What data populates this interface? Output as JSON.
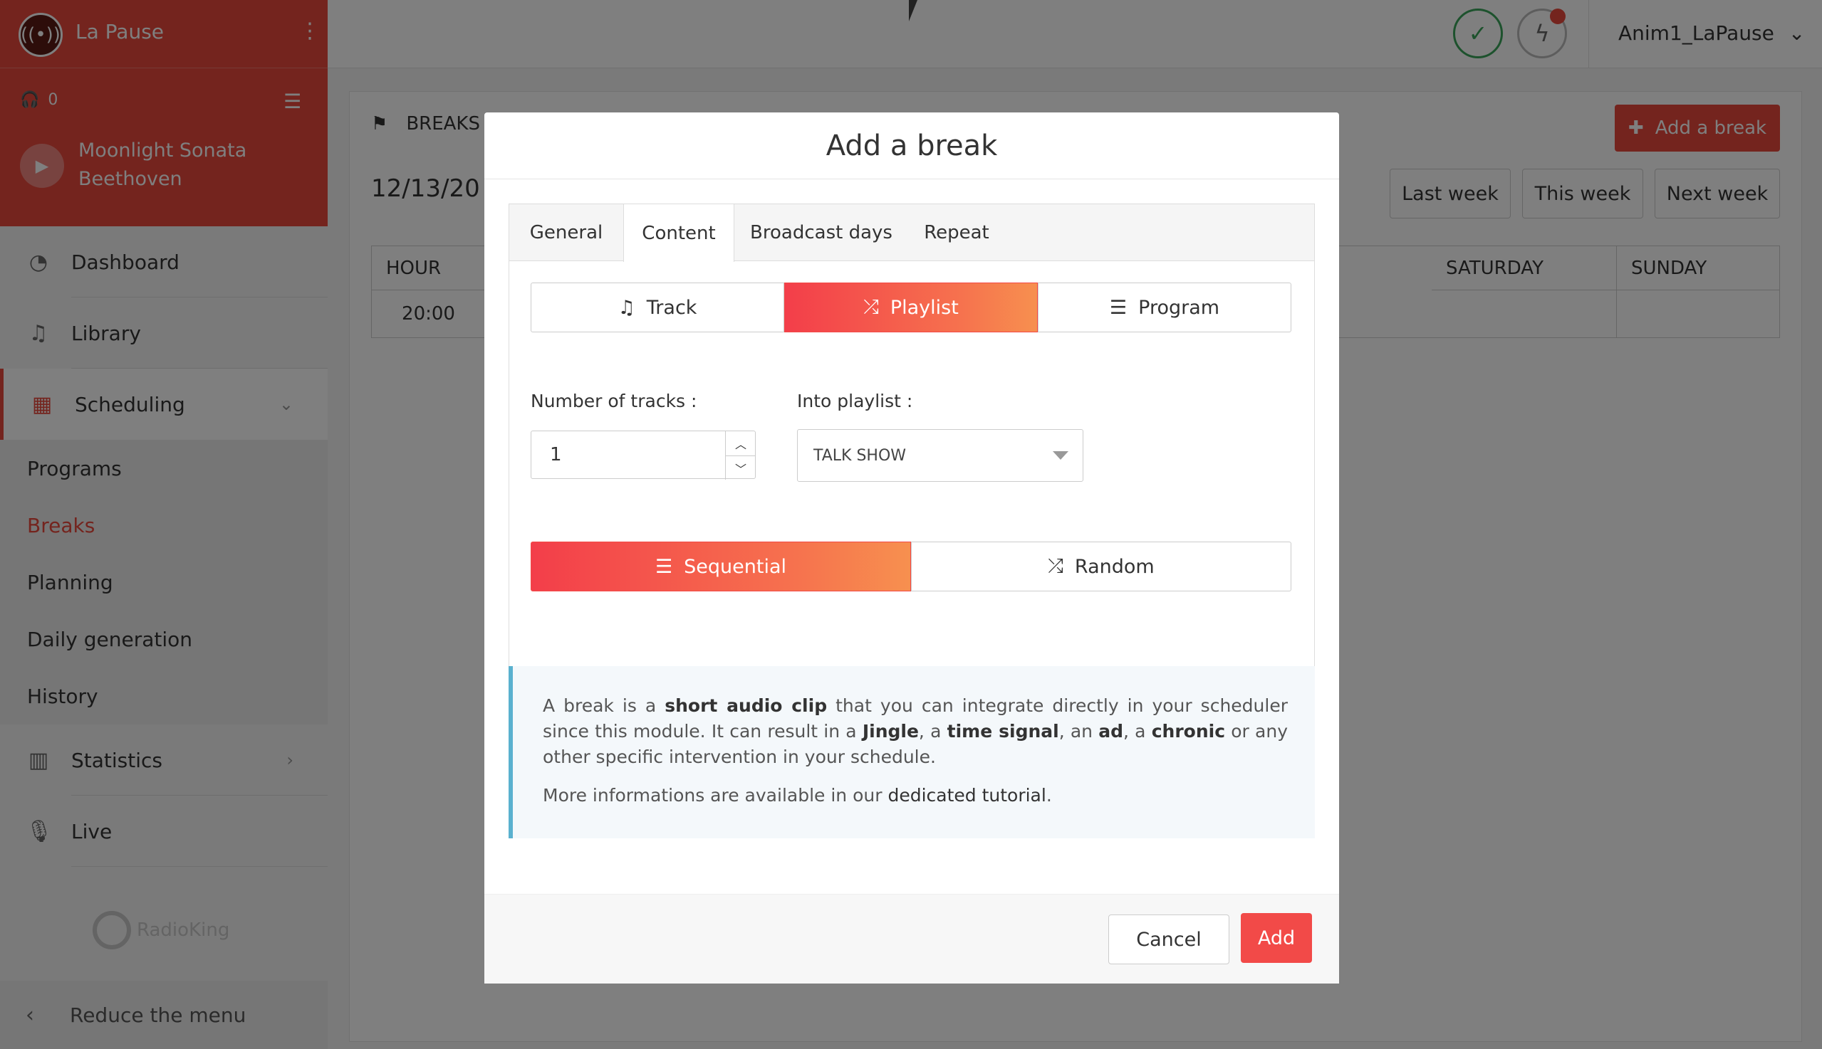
{
  "sidebar": {
    "radio_name": "La Pause",
    "listeners_count": "0",
    "now_playing": {
      "title": "Moonlight Sonata",
      "artist": "Beethoven"
    },
    "nav": {
      "dashboard": "Dashboard",
      "library": "Library",
      "scheduling": "Scheduling",
      "statistics": "Statistics",
      "live": "Live"
    },
    "scheduling_sub": {
      "programs": "Programs",
      "breaks": "Breaks",
      "planning": "Planning",
      "daily_generation": "Daily generation",
      "history": "History"
    },
    "brand": "RadioKing",
    "reduce_menu": "Reduce the menu"
  },
  "topbar": {
    "user": "Anim1_LaPause"
  },
  "breaks_page": {
    "title": "BREAKS",
    "add_button": "Add a break",
    "date_range": "12/13/20",
    "week_buttons": {
      "last": "Last week",
      "this": "This week",
      "next": "Next week"
    },
    "table": {
      "headers": {
        "hour": "HOUR",
        "saturday": "SATURDAY",
        "sunday": "SUNDAY"
      },
      "rows": [
        {
          "hour": "20:00"
        }
      ]
    }
  },
  "modal": {
    "title": "Add a break",
    "tabs": {
      "general": "General",
      "content": "Content",
      "broadcast_days": "Broadcast days",
      "repeat": "Repeat"
    },
    "content_type": {
      "track": "Track",
      "playlist": "Playlist",
      "program": "Program",
      "selected": "playlist"
    },
    "number_of_tracks": {
      "label": "Number of tracks :",
      "value": "1"
    },
    "into_playlist": {
      "label": "Into playlist :",
      "value": "TALK SHOW"
    },
    "order": {
      "sequential": "Sequential",
      "random": "Random",
      "selected": "sequential"
    },
    "info": {
      "p1_a": "A break is a ",
      "p1_b": "short audio clip",
      "p1_c": " that you can integrate directly in your scheduler since this module. It can result in a ",
      "p1_d": "Jingle",
      "p1_e": ", a ",
      "p1_f": "time signal",
      "p1_g": ", an ",
      "p1_h": "ad",
      "p1_i": ", a ",
      "p1_j": "chronic",
      "p1_k": " or any other specific intervention in your schedule.",
      "p2_a": "More informations are available in our ",
      "p2_link": "dedicated tutorial",
      "p2_b": "."
    },
    "footer": {
      "cancel": "Cancel",
      "add": "Add"
    }
  },
  "colors": {
    "accent": "#e8483c",
    "gradient_start": "#f33e4a",
    "gradient_end": "#f7904f",
    "info_border": "#5ab1cf",
    "status_ok": "#3aa55a"
  }
}
